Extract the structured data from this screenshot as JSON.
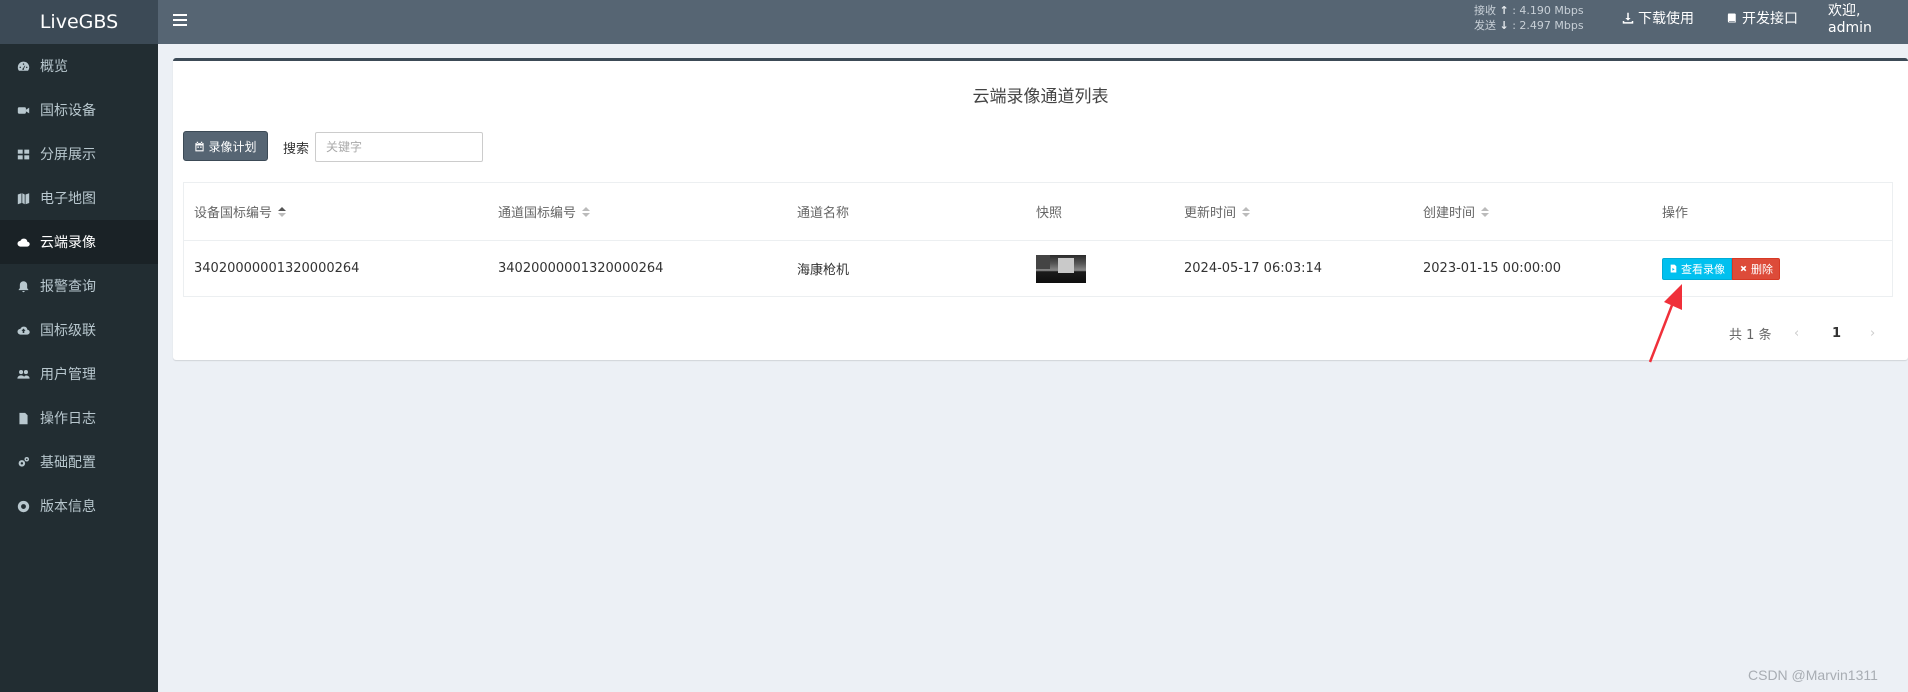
{
  "app": {
    "logo": "LiveGBS"
  },
  "sidebar": {
    "items": [
      {
        "label": "概览",
        "icon": "dashboard-icon"
      },
      {
        "label": "国标设备",
        "icon": "video-camera-icon"
      },
      {
        "label": "分屏展示",
        "icon": "grid-icon"
      },
      {
        "label": "电子地图",
        "icon": "map-icon"
      },
      {
        "label": "云端录像",
        "icon": "cloud-icon",
        "active": true
      },
      {
        "label": "报警查询",
        "icon": "bell-icon"
      },
      {
        "label": "国标级联",
        "icon": "cloud-upload-icon"
      },
      {
        "label": "用户管理",
        "icon": "users-icon"
      },
      {
        "label": "操作日志",
        "icon": "file-icon"
      },
      {
        "label": "基础配置",
        "icon": "gears-icon"
      },
      {
        "label": "版本信息",
        "icon": "life-ring-icon"
      }
    ]
  },
  "header": {
    "bandwidth": {
      "recv_label": "接收",
      "recv_arrow": "↑",
      "recv_value": "4.190 Mbps",
      "send_label": "发送",
      "send_arrow": "↓",
      "send_value": "2.497 Mbps"
    },
    "download_label": "下载使用",
    "api_label": "开发接口",
    "welcome": "欢迎, admin"
  },
  "main": {
    "title": "云端录像通道列表",
    "plan_button": "录像计划",
    "search_label": "搜索",
    "search_placeholder": "关键字",
    "table": {
      "columns": [
        "设备国标编号",
        "通道国标编号",
        "通道名称",
        "快照",
        "更新时间",
        "创建时间",
        "操作"
      ],
      "rows": [
        {
          "device_id": "34020000001320000264",
          "channel_id": "34020000001320000264",
          "channel_name": "海康枪机",
          "updated": "2024-05-17 06:03:14",
          "created": "2023-01-15 00:00:00",
          "view_label": "查看录像",
          "delete_label": "删除"
        }
      ]
    },
    "pagination": {
      "total": "共 1 条",
      "prev": "‹",
      "page": "1",
      "next": "›"
    }
  },
  "colors": {
    "sidebar_bg": "#222d32",
    "header_bg": "#566573",
    "view_button": "#00c0ef",
    "delete_button": "#dd4b39",
    "annotation_arrow": "#f0303a"
  },
  "watermark": "CSDN @Marvin1311"
}
